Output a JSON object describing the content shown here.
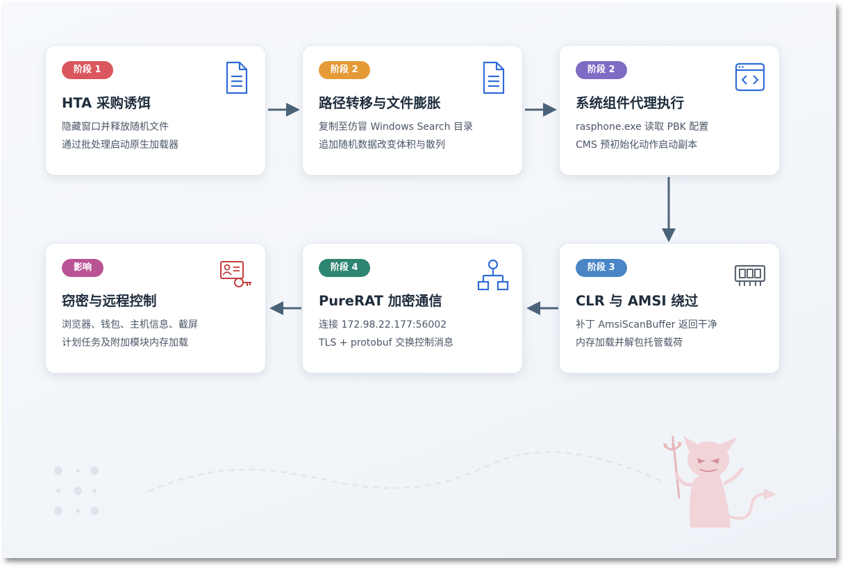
{
  "colors": {
    "red": "#d9575d",
    "orange": "#e59a37",
    "purple": "#7e6bc4",
    "blue": "#4a86c5",
    "green": "#2e8571",
    "pink": "#b95494",
    "arrow": "#4b6379",
    "icon_blue": "#2e6ad8",
    "icon_red": "#c43c3c",
    "icon_gray": "#5b6470"
  },
  "cards": [
    {
      "badge": "阶段 1",
      "title": "HTA 采购诱饵",
      "line1": "隐藏窗口并释放随机文件",
      "line2": "通过批处理启动原生加载器",
      "icon": "document-icon"
    },
    {
      "badge": "阶段 2",
      "title": "路径转移与文件膨胀",
      "line1": "复制至仿冒 Windows Search 目录",
      "line2": "追加随机数据改变体积与散列",
      "icon": "document-icon"
    },
    {
      "badge": "阶段 2",
      "title": "系统组件代理执行",
      "line1": "rasphone.exe 读取 PBK 配置",
      "line2": "CMS 预初始化动作启动副本",
      "icon": "code-window-icon"
    },
    {
      "badge": "阶段 3",
      "title": "CLR 与 AMSI 绕过",
      "line1": "补丁 AmsiScanBuffer 返回干净",
      "line2": "内存加载并解包托管载荷",
      "icon": "memory-chip-icon"
    },
    {
      "badge": "阶段 4",
      "title": "PureRAT 加密通信",
      "line1": "连接 172.98.22.177:56002",
      "line2": "TLS + protobuf 交换控制消息",
      "icon": "network-icon"
    },
    {
      "badge": "影响",
      "title": "窃密与远程控制",
      "line1": "浏览器、钱包、主机信息、截屏",
      "line2": "计划任务及附加模块内存加载",
      "icon": "credential-key-icon"
    }
  ]
}
